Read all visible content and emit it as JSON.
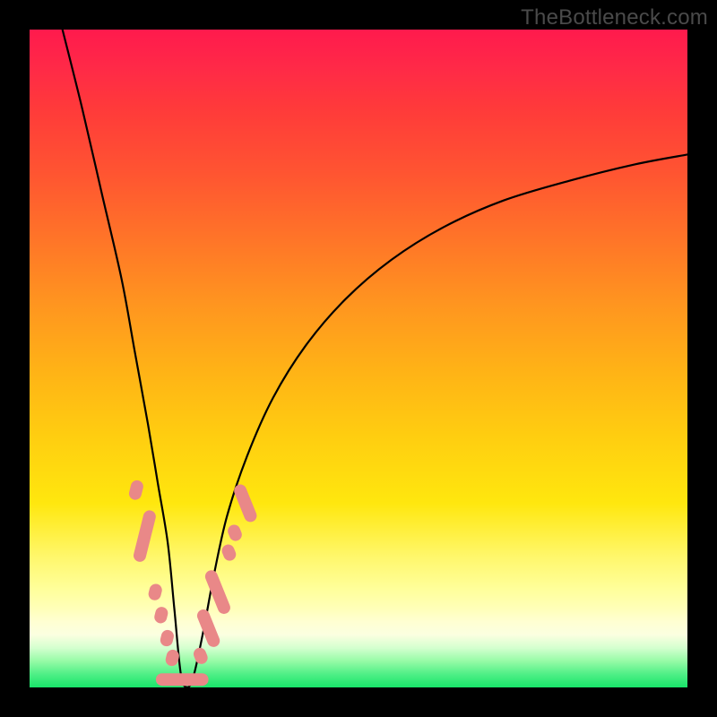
{
  "watermark": "TheBottleneck.com",
  "colors": {
    "frame": "#000000",
    "line": "#000000",
    "marker": "#e98888"
  },
  "chart_data": {
    "type": "line",
    "title": "",
    "xlabel": "",
    "ylabel": "",
    "xlim": [
      0,
      100
    ],
    "ylim": [
      0,
      100
    ],
    "notes": "Bottleneck-style V curve. X axis = relative component position (0-100). Y axis = bottleneck % (0 at bottom = no bottleneck, 100 at top = full bottleneck). Valley minimum near x≈23, y≈0.",
    "series": [
      {
        "name": "bottleneck-curve",
        "x": [
          5,
          8,
          11,
          14,
          16,
          18,
          19.5,
          21,
          22,
          23,
          24,
          25,
          26.5,
          28,
          30,
          33,
          37,
          42,
          48,
          55,
          63,
          72,
          82,
          92,
          100
        ],
        "y": [
          100,
          88,
          75,
          62,
          51,
          40,
          31,
          22,
          12,
          2,
          0,
          2,
          9,
          17,
          26,
          35,
          44,
          52,
          59,
          65,
          70,
          74,
          77,
          79.5,
          81
        ]
      }
    ],
    "markers": {
      "name": "highlighted-points",
      "note": "Pink lozenge-shaped points near the valley of the curve",
      "points": [
        {
          "x": 16.2,
          "y": 30,
          "len": 3
        },
        {
          "x": 17.5,
          "y": 23,
          "len": 8
        },
        {
          "x": 19.1,
          "y": 14.5,
          "len": 2.5
        },
        {
          "x": 20.0,
          "y": 11,
          "len": 2.5
        },
        {
          "x": 20.9,
          "y": 7.5,
          "len": 2.5
        },
        {
          "x": 21.7,
          "y": 4.5,
          "len": 2.5
        },
        {
          "x": 23.2,
          "y": 1.2,
          "len": 8,
          "horiz": true
        },
        {
          "x": 26.0,
          "y": 4.8,
          "len": 2.5
        },
        {
          "x": 27.2,
          "y": 9,
          "len": 6
        },
        {
          "x": 28.6,
          "y": 14.5,
          "len": 7
        },
        {
          "x": 30.3,
          "y": 20.5,
          "len": 2.5
        },
        {
          "x": 31.2,
          "y": 23.5,
          "len": 2.5
        },
        {
          "x": 32.8,
          "y": 28,
          "len": 6
        }
      ]
    }
  }
}
